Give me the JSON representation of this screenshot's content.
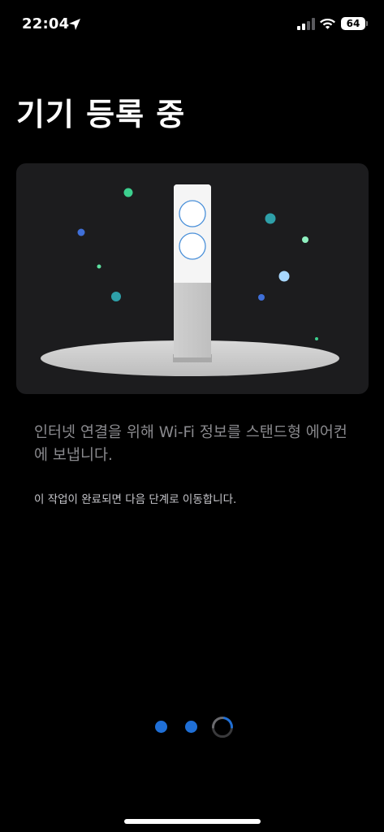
{
  "status_bar": {
    "time": "22:04",
    "battery_level": "64",
    "icons": [
      "location-arrow-icon",
      "cellular-signal-icon",
      "wifi-icon",
      "battery-icon"
    ]
  },
  "title": "기기 등록 중",
  "illustration": {
    "subject": "standing-air-conditioner-illustration"
  },
  "description": "인터넷 연결을 위해 Wi-Fi 정보를 스탠드형 에어컨에 보냅니다.",
  "note": "이 작업이 완료되면 다음 단계로 이동합니다.",
  "progress": {
    "steps_total": 3,
    "steps_completed": 2,
    "current_step": 3,
    "accent_color": "#1f6fd6"
  },
  "colors": {
    "background": "#000000",
    "card": "#1c1c1e",
    "accent": "#1f6fd6"
  }
}
